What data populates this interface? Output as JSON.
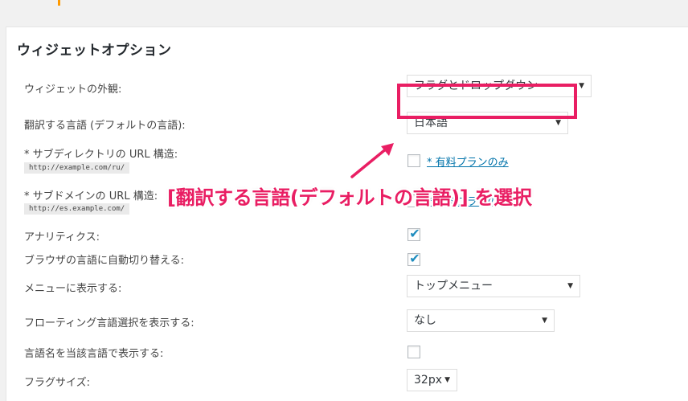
{
  "section_title": "ウィジェットオプション",
  "rows": {
    "appearance": {
      "label": "ウィジェットの外観:",
      "value": "フラグとドロップダウン"
    },
    "default_language": {
      "label": "翻訳する言語 (デフォルトの言語):",
      "value": "日本語"
    },
    "subdirectory": {
      "label": "* サブディレクトリの URL 構造:",
      "example": "http://example.com/ru/",
      "link": "* 有料プランのみ"
    },
    "subdomain": {
      "label": "* サブドメインの URL 構造:",
      "example": "http://es.example.com/",
      "link": "* 有料プランのみ"
    },
    "analytics": {
      "label": "アナリティクス:",
      "checked": true
    },
    "auto_switch": {
      "label": "ブラウザの言語に自動切り替える:",
      "checked": true
    },
    "menu": {
      "label": "メニューに表示する:",
      "value": "トップメニュー"
    },
    "floating": {
      "label": "フローティング言語選択を表示する:",
      "value": "なし"
    },
    "native_names": {
      "label": "言語名を当該言語で表示する:",
      "checked": false
    },
    "flag_size": {
      "label": "フラグサイズ:",
      "value": "32px"
    }
  },
  "annotation": {
    "text": "[翻訳する言語(デフォルトの言語)] を選択",
    "color": "#e91e63"
  },
  "icons": {
    "dropdown": "▼",
    "check": "✔"
  }
}
